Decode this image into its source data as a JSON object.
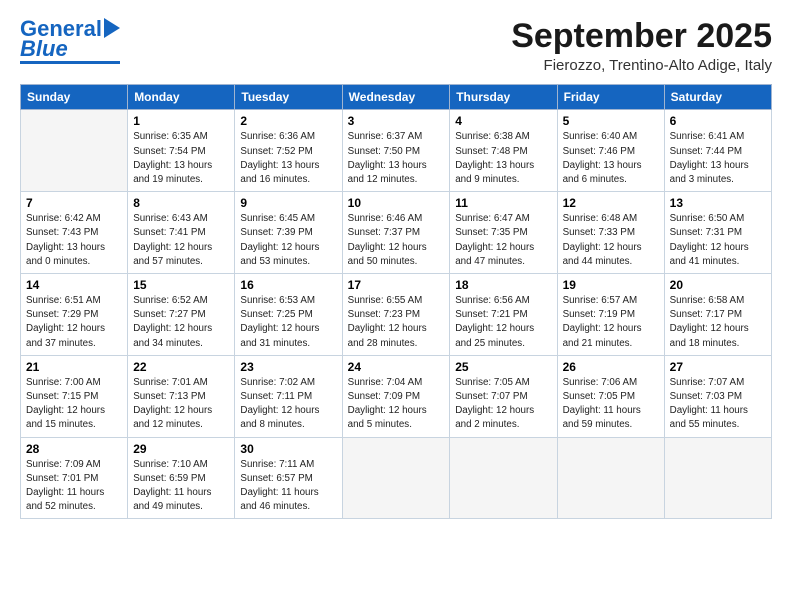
{
  "header": {
    "logo_line1": "General",
    "logo_line2": "Blue",
    "month": "September 2025",
    "location": "Fierozzo, Trentino-Alto Adige, Italy"
  },
  "weekdays": [
    "Sunday",
    "Monday",
    "Tuesday",
    "Wednesday",
    "Thursday",
    "Friday",
    "Saturday"
  ],
  "weeks": [
    [
      {
        "day": "",
        "info": ""
      },
      {
        "day": "1",
        "info": "Sunrise: 6:35 AM\nSunset: 7:54 PM\nDaylight: 13 hours\nand 19 minutes."
      },
      {
        "day": "2",
        "info": "Sunrise: 6:36 AM\nSunset: 7:52 PM\nDaylight: 13 hours\nand 16 minutes."
      },
      {
        "day": "3",
        "info": "Sunrise: 6:37 AM\nSunset: 7:50 PM\nDaylight: 13 hours\nand 12 minutes."
      },
      {
        "day": "4",
        "info": "Sunrise: 6:38 AM\nSunset: 7:48 PM\nDaylight: 13 hours\nand 9 minutes."
      },
      {
        "day": "5",
        "info": "Sunrise: 6:40 AM\nSunset: 7:46 PM\nDaylight: 13 hours\nand 6 minutes."
      },
      {
        "day": "6",
        "info": "Sunrise: 6:41 AM\nSunset: 7:44 PM\nDaylight: 13 hours\nand 3 minutes."
      }
    ],
    [
      {
        "day": "7",
        "info": "Sunrise: 6:42 AM\nSunset: 7:43 PM\nDaylight: 13 hours\nand 0 minutes."
      },
      {
        "day": "8",
        "info": "Sunrise: 6:43 AM\nSunset: 7:41 PM\nDaylight: 12 hours\nand 57 minutes."
      },
      {
        "day": "9",
        "info": "Sunrise: 6:45 AM\nSunset: 7:39 PM\nDaylight: 12 hours\nand 53 minutes."
      },
      {
        "day": "10",
        "info": "Sunrise: 6:46 AM\nSunset: 7:37 PM\nDaylight: 12 hours\nand 50 minutes."
      },
      {
        "day": "11",
        "info": "Sunrise: 6:47 AM\nSunset: 7:35 PM\nDaylight: 12 hours\nand 47 minutes."
      },
      {
        "day": "12",
        "info": "Sunrise: 6:48 AM\nSunset: 7:33 PM\nDaylight: 12 hours\nand 44 minutes."
      },
      {
        "day": "13",
        "info": "Sunrise: 6:50 AM\nSunset: 7:31 PM\nDaylight: 12 hours\nand 41 minutes."
      }
    ],
    [
      {
        "day": "14",
        "info": "Sunrise: 6:51 AM\nSunset: 7:29 PM\nDaylight: 12 hours\nand 37 minutes."
      },
      {
        "day": "15",
        "info": "Sunrise: 6:52 AM\nSunset: 7:27 PM\nDaylight: 12 hours\nand 34 minutes."
      },
      {
        "day": "16",
        "info": "Sunrise: 6:53 AM\nSunset: 7:25 PM\nDaylight: 12 hours\nand 31 minutes."
      },
      {
        "day": "17",
        "info": "Sunrise: 6:55 AM\nSunset: 7:23 PM\nDaylight: 12 hours\nand 28 minutes."
      },
      {
        "day": "18",
        "info": "Sunrise: 6:56 AM\nSunset: 7:21 PM\nDaylight: 12 hours\nand 25 minutes."
      },
      {
        "day": "19",
        "info": "Sunrise: 6:57 AM\nSunset: 7:19 PM\nDaylight: 12 hours\nand 21 minutes."
      },
      {
        "day": "20",
        "info": "Sunrise: 6:58 AM\nSunset: 7:17 PM\nDaylight: 12 hours\nand 18 minutes."
      }
    ],
    [
      {
        "day": "21",
        "info": "Sunrise: 7:00 AM\nSunset: 7:15 PM\nDaylight: 12 hours\nand 15 minutes."
      },
      {
        "day": "22",
        "info": "Sunrise: 7:01 AM\nSunset: 7:13 PM\nDaylight: 12 hours\nand 12 minutes."
      },
      {
        "day": "23",
        "info": "Sunrise: 7:02 AM\nSunset: 7:11 PM\nDaylight: 12 hours\nand 8 minutes."
      },
      {
        "day": "24",
        "info": "Sunrise: 7:04 AM\nSunset: 7:09 PM\nDaylight: 12 hours\nand 5 minutes."
      },
      {
        "day": "25",
        "info": "Sunrise: 7:05 AM\nSunset: 7:07 PM\nDaylight: 12 hours\nand 2 minutes."
      },
      {
        "day": "26",
        "info": "Sunrise: 7:06 AM\nSunset: 7:05 PM\nDaylight: 11 hours\nand 59 minutes."
      },
      {
        "day": "27",
        "info": "Sunrise: 7:07 AM\nSunset: 7:03 PM\nDaylight: 11 hours\nand 55 minutes."
      }
    ],
    [
      {
        "day": "28",
        "info": "Sunrise: 7:09 AM\nSunset: 7:01 PM\nDaylight: 11 hours\nand 52 minutes."
      },
      {
        "day": "29",
        "info": "Sunrise: 7:10 AM\nSunset: 6:59 PM\nDaylight: 11 hours\nand 49 minutes."
      },
      {
        "day": "30",
        "info": "Sunrise: 7:11 AM\nSunset: 6:57 PM\nDaylight: 11 hours\nand 46 minutes."
      },
      {
        "day": "",
        "info": ""
      },
      {
        "day": "",
        "info": ""
      },
      {
        "day": "",
        "info": ""
      },
      {
        "day": "",
        "info": ""
      }
    ]
  ]
}
